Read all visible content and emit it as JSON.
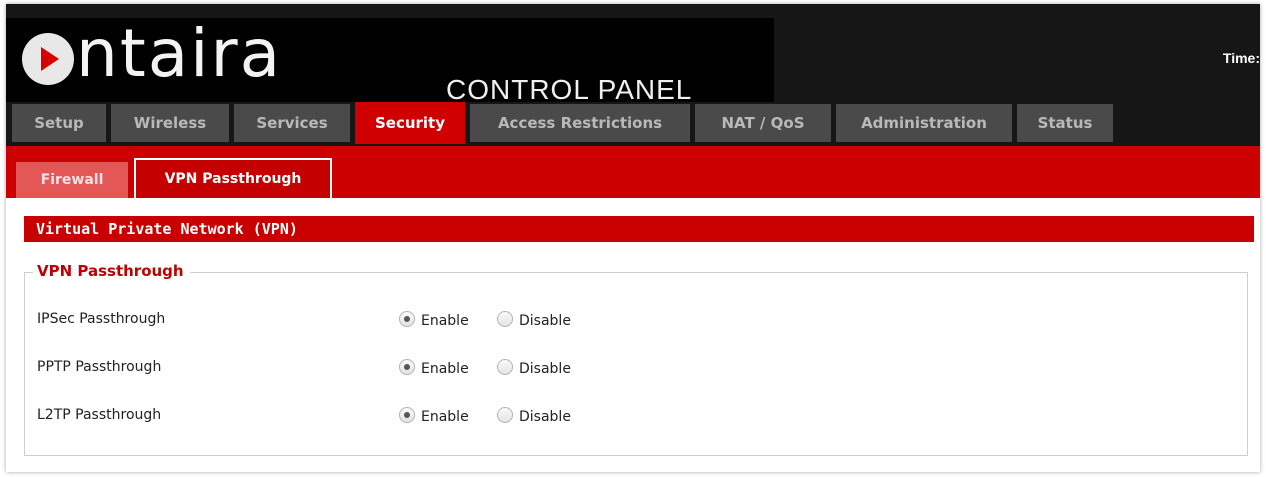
{
  "header": {
    "logo_text": "antaira",
    "subtitle": "CONTROL PANEL",
    "time_label": "Time:"
  },
  "main_tabs": [
    {
      "label": "Setup",
      "active": false
    },
    {
      "label": "Wireless",
      "active": false
    },
    {
      "label": "Services",
      "active": false
    },
    {
      "label": "Security",
      "active": true
    },
    {
      "label": "Access Restrictions",
      "active": false
    },
    {
      "label": "NAT / QoS",
      "active": false
    },
    {
      "label": "Administration",
      "active": false
    },
    {
      "label": "Status",
      "active": false
    }
  ],
  "sub_tabs": [
    {
      "label": "Firewall",
      "active": false
    },
    {
      "label": "VPN Passthrough",
      "active": true
    }
  ],
  "section": {
    "title": "Virtual Private Network (VPN)",
    "fieldset_legend": "VPN Passthrough",
    "rows": [
      {
        "label": "IPSec Passthrough",
        "enable_label": "Enable",
        "disable_label": "Disable",
        "selected": "Enable"
      },
      {
        "label": "PPTP Passthrough",
        "enable_label": "Enable",
        "disable_label": "Disable",
        "selected": "Enable"
      },
      {
        "label": "L2TP Passthrough",
        "enable_label": "Enable",
        "disable_label": "Disable",
        "selected": "Enable"
      }
    ]
  },
  "colors": {
    "brand_red": "#cc0000",
    "header_bg": "#161616",
    "inactive_tab": "#4a4a4a"
  }
}
